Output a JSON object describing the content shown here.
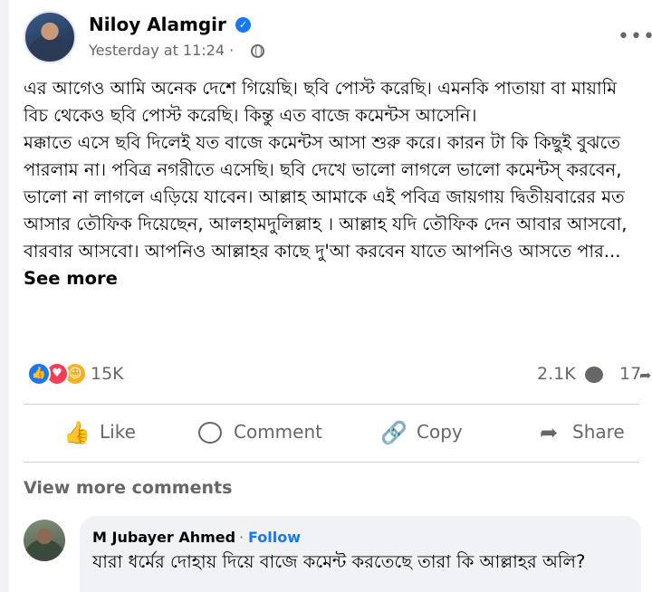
{
  "post": {
    "author_name": "Niloy Alamgir",
    "timestamp": "Yesterday at 11:24",
    "separator": "·",
    "paragraphs": [
      "এর আগেও আমি অনেক দেশে গিয়েছি। ছবি পোস্ট করেছি। এমনকি পাতায়া বা মায়ামি বিচ থেকেও ছবি পোস্ট করেছি। কিন্তু এত বাজে কমেন্টস আসেনি।",
      "মক্কাতে এসে ছবি দিলেই যত বাজে কমেন্টস আসা শুরু করে। কারন টা কি কিছুই বুঝতে পারলাম না। পবিত্র নগরীতে এসেছি। ছবি দেখে ভালো লাগলে ভালো কমেন্টস্ করবেন, ভালো না লাগলে এড়িয়ে যাবেন। আল্লাহ আমাকে এই পবিত্র জায়গায় দ্বিতীয়বারের মত আসার তৌফিক দিয়েছেন, আলহামদুলিল্লাহ । আল্লাহ যদি তৌফিক দেন আবার আসবো, বারবার আসবো। আপনিও আল্লাহর কাছে দু'আ করবেন যাতে আপনিও আসতে পার..."
    ],
    "see_more": "See more"
  },
  "stats": {
    "reactions": "15K",
    "comments": "2.1K",
    "shares": "17"
  },
  "actions": {
    "like": "Like",
    "comment": "Comment",
    "copy": "Copy",
    "share": "Share"
  },
  "view_more_comments": "View more comments",
  "comment": {
    "author": "M Jubayer Ahmed",
    "dot": "·",
    "follow": "Follow",
    "text": "যারা ধর্মের দোহায় দিয়ে বাজে কমেন্ট করতেছে তারা কি আল্লাহর অলি?"
  },
  "icons": {
    "verified": "verified-badge-icon",
    "privacy": "globe-icon",
    "more": "more-options-icon",
    "like": "thumbs-up-icon",
    "comment": "speech-bubble-icon",
    "copy": "link-icon",
    "share": "share-arrow-icon"
  },
  "colors": {
    "accent": "#1877f2",
    "secondary_text": "#65676b",
    "love": "#f33e58",
    "care": "#f7b125"
  }
}
